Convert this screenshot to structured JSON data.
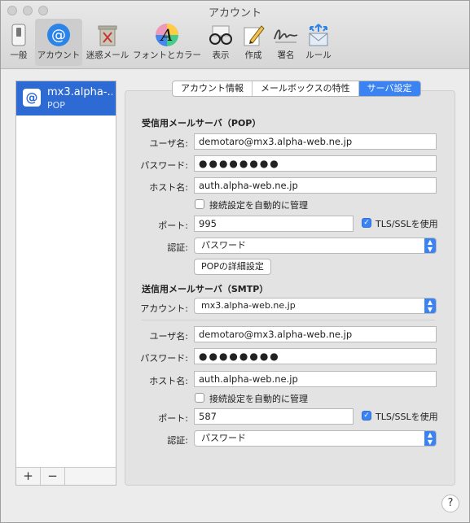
{
  "window": {
    "title": "アカウント"
  },
  "toolbar": {
    "items": [
      {
        "label": "一般"
      },
      {
        "label": "アカウント"
      },
      {
        "label": "迷惑メール"
      },
      {
        "label": "フォントとカラー"
      },
      {
        "label": "表示"
      },
      {
        "label": "作成"
      },
      {
        "label": "署名"
      },
      {
        "label": "ルール"
      }
    ]
  },
  "sidebar": {
    "account": {
      "name": "mx3.alpha-...",
      "type": "POP",
      "icon": "@"
    },
    "add_label": "+",
    "remove_label": "−"
  },
  "tabs": [
    {
      "label": "アカウント情報"
    },
    {
      "label": "メールボックスの特性"
    },
    {
      "label": "サーバ設定"
    }
  ],
  "incoming": {
    "title": "受信用メールサーバ（POP）",
    "username_label": "ユーザ名:",
    "username": "demotaro@mx3.alpha-web.ne.jp",
    "password_label": "パスワード:",
    "password": "●●●●●●●●",
    "host_label": "ホスト名:",
    "host": "auth.alpha-web.ne.jp",
    "auto_manage_label": "接続設定を自動的に管理",
    "port_label": "ポート:",
    "port": "995",
    "tls_label": "TLS/SSLを使用",
    "auth_label": "認証:",
    "auth": "パスワード",
    "advanced_button": "POPの詳細設定"
  },
  "outgoing": {
    "title": "送信用メールサーバ（SMTP）",
    "account_label": "アカウント:",
    "account": "mx3.alpha-web.ne.jp",
    "username_label": "ユーザ名:",
    "username": "demotaro@mx3.alpha-web.ne.jp",
    "password_label": "パスワード:",
    "password": "●●●●●●●●",
    "host_label": "ホスト名:",
    "host": "auth.alpha-web.ne.jp",
    "auto_manage_label": "接続設定を自動的に管理",
    "port_label": "ポート:",
    "port": "587",
    "tls_label": "TLS/SSLを使用",
    "auth_label": "認証:",
    "auth": "パスワード"
  },
  "help": {
    "label": "?"
  },
  "colors": {
    "accent": "#3b82f2",
    "selection": "#2d6ad4"
  }
}
